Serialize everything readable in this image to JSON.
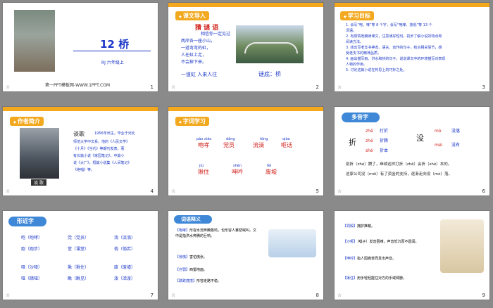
{
  "slides": [
    {
      "num": "1",
      "title": "12 桥",
      "subtitle": "RJ  六年级上",
      "footer": "第一PPT模板网-WWW.1PPT.COM"
    },
    {
      "num": "2",
      "tag": "课文导入",
      "riddle_title": "猜 谜 语",
      "riddle_lines": [
        "相信你一定见过",
        "两岸各一座小山，",
        "一道弯弯的虹，",
        "人在虹上走，",
        "不会掉下来。"
      ],
      "answer_label": "谜底：",
      "answer": "桥",
      "line_bottom": "一道虹 人来人往"
    },
    {
      "num": "3",
      "tag": "学习目标",
      "goals": [
        "1. 会写“咆、哮”等 8 个字，会写“咆哮、放低”等 13 个",
        "   词语。",
        "2. 有感情地朗读课文，注意读好短句。初步了解小说的特点和",
        "   阅读方法。",
        "3. 找出写老支书神态、语言、动作的句子，结合相关情节，感",
        "   受老支书的精神品质。",
        "4. 画出描写雨、洪水和桥的句子，说说课文中的环境描写对表现",
        "   人物的作用。",
        "5. 讨论这篇小说在构思上的巧妙之处。"
      ]
    },
    {
      "num": "4",
      "tag": "作者简介",
      "name": "谈歌",
      "intro": [
        "1956年出生。毕业于河北",
        "师范大学中文系。他的《人民文学》",
        "《十月》《当代》等期刊发表。著",
        "有长篇小说《家园笔记》，中篇小",
        "说《大厂》，短篇小说集《人间笔记》",
        "《绝唱》等。"
      ],
      "caption": "谈  歌"
    },
    {
      "num": "5",
      "tag": "字词学习",
      "rows": [
        [
          {
            "py": "páo xiào",
            "hz": "咆哮"
          },
          {
            "py": "dǎng",
            "hz": "党员"
          },
          {
            "py": "tōng",
            "hz": "流淌"
          },
          {
            "py": "qiào",
            "hz": "呕话"
          }
        ],
        [
          {
            "py": "jiù",
            "hz": "揪住"
          },
          {
            "py": "shēn",
            "hz": "呻吟"
          },
          {
            "py": "fèi",
            "hz": "废墟"
          }
        ]
      ]
    },
    {
      "num": "6",
      "tag": "多音字",
      "char1": "折",
      "items1": [
        {
          "py": "zhē",
          "word": "打折"
        },
        {
          "py": "zhé",
          "word": "折腾"
        },
        {
          "py": "shé",
          "word": "折本"
        }
      ],
      "char2": "没",
      "items2": [
        {
          "py": "mò",
          "word": "没落"
        },
        {
          "py": "méi",
          "word": "没有"
        }
      ],
      "sentence1": "别折（zhé）腾了，继续这样打折（zhē）会折（shé）本的。",
      "sentence2": "这家公司没（méi）有了资金的支持，逐渐走向没（mò）落。"
    },
    {
      "num": "7",
      "tag": "形近字",
      "groups": [
        [
          "咆（咆哮）",
          "跑（跑步）"
        ],
        [
          "党（党员）",
          "堂（课堂）"
        ],
        [
          "淌（流淌）",
          "倘（倘若）"
        ],
        [
          "哑（沙哑）",
          "哑（暗哑）"
        ],
        [
          "揪（揪住）",
          "瞅（瞅见）"
        ],
        [
          "废（废墟）",
          "泼（活泼）"
        ]
      ]
    },
    {
      "num": "8",
      "tag": "词语释义",
      "entries": [
        {
          "k": "【咆哮】",
          "v": "形容水流奔腾轰鸣，也形容人暴怒喊叫。文中是指洪水奔腾的巨响。"
        },
        {
          "k": "【惊慌】",
          "v": "害怕慌张。"
        },
        {
          "k": "【疗弱】",
          "v": "西蜀地面。"
        },
        {
          "k": "【跌跌撞撞】",
          "v": "形容走路不稳。"
        }
      ]
    },
    {
      "num": "9",
      "entries": [
        {
          "k": "【祠殿】",
          "v": "拥护推戴。"
        },
        {
          "k": "【沙哑】",
          "v": "（嗓子）发音困难，声音低沉而不圆润。"
        },
        {
          "k": "【呻吟】",
          "v": "指人因痛苦而发出声音。"
        },
        {
          "k": "【揪住】",
          "v": "用手轻轻握住对方的手或臂膀。"
        }
      ]
    }
  ],
  "colors": {
    "accent": "#f2a91f",
    "title_blue": "#1a36c7",
    "red": "#d0201a"
  }
}
